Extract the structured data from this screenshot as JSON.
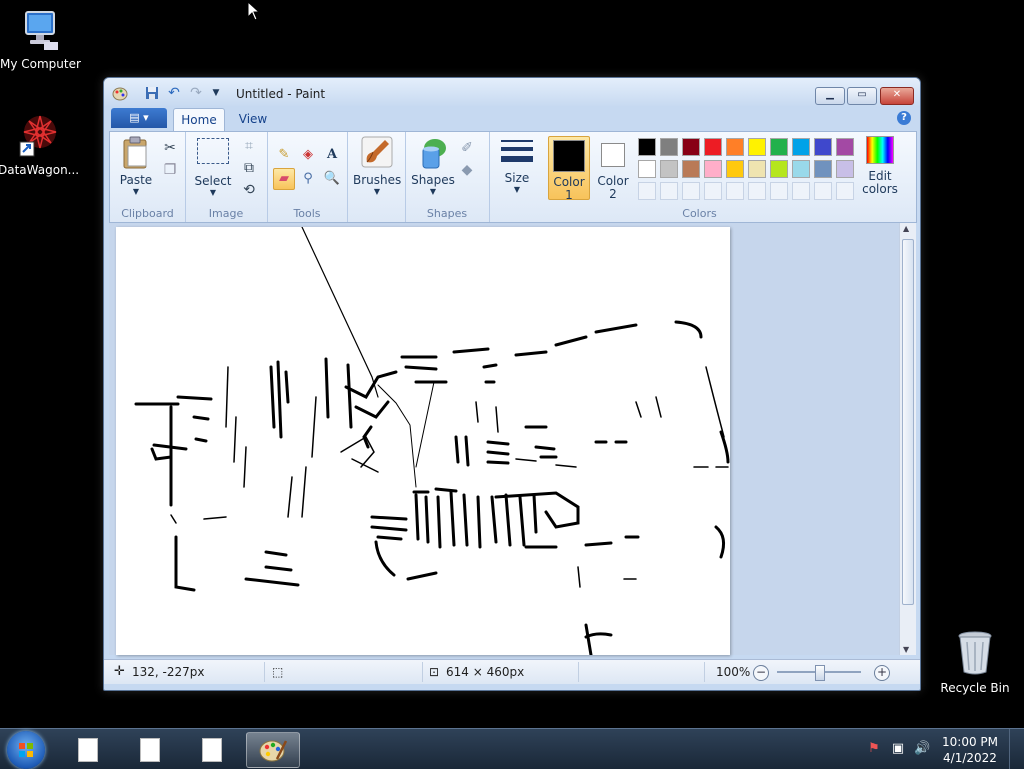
{
  "desktop": {
    "icons": [
      {
        "label": "My Computer",
        "icon": "computer-icon"
      },
      {
        "label": "DataWagon...",
        "icon": "datawagon-icon"
      },
      {
        "label": "Recycle Bin",
        "icon": "recycle-bin-icon"
      }
    ]
  },
  "window": {
    "title": "Untitled - Paint",
    "tabs": [
      {
        "label": "Home"
      },
      {
        "label": "View"
      }
    ],
    "ribbon": {
      "clipboard": {
        "label": "Clipboard",
        "paste": "Paste"
      },
      "image": {
        "label": "Image",
        "select": "Select"
      },
      "tools": {
        "label": "Tools"
      },
      "brushes": "Brushes",
      "shapes": {
        "label": "Shapes",
        "shapes_btn": "Shapes"
      },
      "size": "Size",
      "colors": {
        "label": "Colors",
        "color1_line1": "Color",
        "color1_line2": "1",
        "color2_line1": "Color",
        "color2_line2": "2",
        "color1_value": "#000000",
        "color2_value": "#ffffff",
        "edit_line1": "Edit",
        "edit_line2": "colors",
        "palette_row1": [
          "#000000",
          "#7f7f7f",
          "#880015",
          "#ed1c24",
          "#ff7f27",
          "#fff200",
          "#22b14c",
          "#00a2e8",
          "#3f48cc",
          "#a349a4"
        ],
        "palette_row2": [
          "#ffffff",
          "#c3c3c3",
          "#b97a57",
          "#ffaec9",
          "#ffc90e",
          "#efe4b0",
          "#b5e61d",
          "#99d9ea",
          "#7092be",
          "#c8bfe7"
        ]
      }
    },
    "status": {
      "cursor_pos": "132, -227px",
      "canvas_size": "614 × 460px",
      "zoom": "100%"
    }
  },
  "taskbar": {
    "time": "10:00 PM",
    "date": "4/1/2022"
  }
}
